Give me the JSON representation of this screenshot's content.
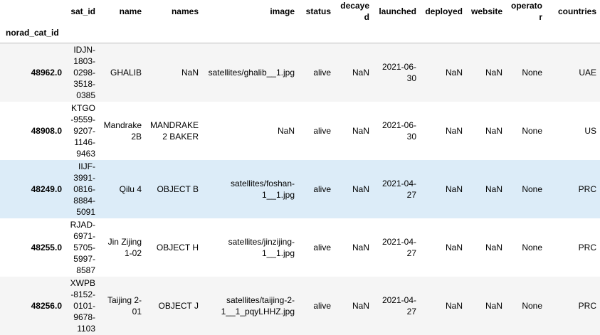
{
  "table": {
    "index_name": "norad_cat_id",
    "columns": [
      "sat_id",
      "name",
      "names",
      "image",
      "status",
      "decayed",
      "launched",
      "deployed",
      "website",
      "operator",
      "countries"
    ],
    "rows": [
      {
        "index": "48962.0",
        "cells": [
          "IDJN-1803-0298-3518-0385",
          "GHALIB",
          "NaN",
          "satellites/ghalib__1.jpg",
          "alive",
          "NaN",
          "2021-06-30",
          "NaN",
          "NaN",
          "None",
          "UAE"
        ]
      },
      {
        "index": "48908.0",
        "cells": [
          "KTGO-9559-9207-1146-9463",
          "Mandrake 2B",
          "MANDRAKE 2 BAKER",
          "NaN",
          "alive",
          "NaN",
          "2021-06-30",
          "NaN",
          "NaN",
          "None",
          "US"
        ]
      },
      {
        "index": "48249.0",
        "cells": [
          "IIJF-3991-0816-8884-5091",
          "Qilu 4",
          "OBJECT B",
          "satellites/foshan-1__1.jpg",
          "alive",
          "NaN",
          "2021-04-27",
          "NaN",
          "NaN",
          "None",
          "PRC"
        ]
      },
      {
        "index": "48255.0",
        "cells": [
          "RJAD-6971-5705-5997-8587",
          "Jin Zijing 1-02",
          "OBJECT H",
          "satellites/jinzijing-1__1.jpg",
          "alive",
          "NaN",
          "2021-04-27",
          "NaN",
          "NaN",
          "None",
          "PRC"
        ]
      },
      {
        "index": "48256.0",
        "cells": [
          "XWPB-8152-0101-9678-1103",
          "Taijing 2-01",
          "OBJECT J",
          "satellites/taijing-2-1__1_pqyLHHZ.jpg",
          "alive",
          "NaN",
          "2021-04-27",
          "NaN",
          "NaN",
          "None",
          "PRC"
        ]
      }
    ],
    "hovered_row": 2
  },
  "colors": {
    "row_odd": "#f5f5f5",
    "row_even": "#ffffff",
    "row_hover": "#dcecf8",
    "header_rule": "#bdbdbd"
  }
}
